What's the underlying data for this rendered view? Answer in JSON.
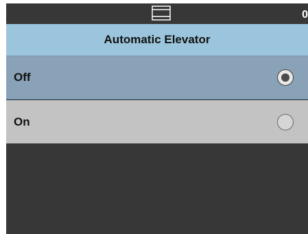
{
  "status_bar": {
    "icon": "document-tray-icon",
    "counter": "0"
  },
  "title_bar": {
    "title": "Automatic Elevator"
  },
  "options": [
    {
      "label": "Off",
      "selected": true
    },
    {
      "label": "On",
      "selected": false
    }
  ],
  "colors": {
    "background": "#373737",
    "title_bar": "#9bc5dc",
    "selected_row": "#8aa2b8",
    "unselected_row": "#c3c3c3"
  }
}
